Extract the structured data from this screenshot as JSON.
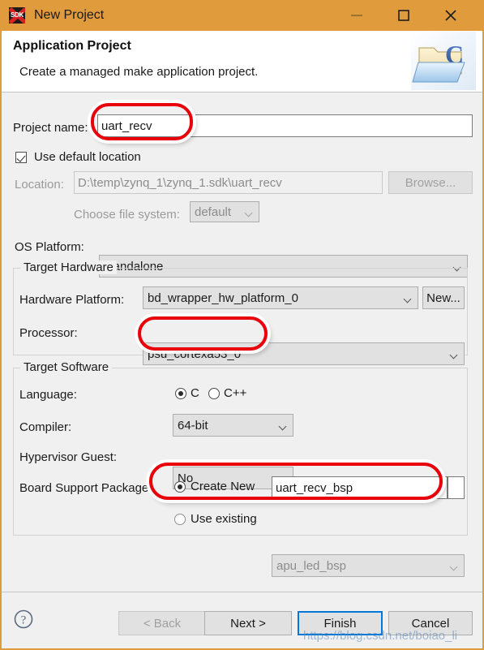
{
  "window": {
    "title": "New Project",
    "app_icon": "sdk-icon",
    "icon_label": "SDK",
    "titlebar_color": "#e09b3d",
    "controls": {
      "minimize": "minimize-icon",
      "maximize": "maximize-icon",
      "close": "close-icon"
    }
  },
  "header": {
    "title": "Application Project",
    "subtitle": "Create a managed make application project.",
    "icon": "c-project-folder-icon"
  },
  "form": {
    "project_name": {
      "label": "Project name:",
      "value": "uart_recv",
      "placeholder": ""
    },
    "use_default_location": {
      "label": "Use default location",
      "checked": true
    },
    "location": {
      "label": "Location:",
      "value": "D:\\temp\\zynq_1\\zynq_1.sdk\\uart_recv",
      "enabled": false
    },
    "browse_button": {
      "label": "Browse...",
      "enabled": false
    },
    "choose_file_system": {
      "label": "Choose file system:",
      "value": "default",
      "enabled": false
    },
    "os_platform": {
      "label": "OS Platform:",
      "value": "standalone"
    }
  },
  "target_hardware": {
    "title": "Target Hardware",
    "hardware_platform": {
      "label": "Hardware Platform:",
      "value": "bd_wrapper_hw_platform_0"
    },
    "new_button": {
      "label": "New..."
    },
    "processor": {
      "label": "Processor:",
      "value": "psu_cortexa53_0"
    }
  },
  "target_software": {
    "title": "Target Software",
    "language": {
      "label": "Language:",
      "options": [
        "C",
        "C++"
      ],
      "selected": "C"
    },
    "compiler": {
      "label": "Compiler:",
      "value": "64-bit"
    },
    "hypervisor_guest": {
      "label": "Hypervisor Guest:",
      "value": "No"
    },
    "board_support_package": {
      "label": "Board Support Package:",
      "create_new": {
        "label": "Create New",
        "selected": true,
        "value": "uart_recv_bsp"
      },
      "use_existing": {
        "label": "Use existing",
        "selected": false,
        "value": "apu_led_bsp",
        "enabled": false
      }
    }
  },
  "footer": {
    "help_icon": "help-question-icon",
    "buttons": {
      "back": {
        "label": "< Back",
        "enabled": false
      },
      "next": {
        "label": "Next >",
        "enabled": true
      },
      "finish": {
        "label": "Finish",
        "enabled": true,
        "default": true
      },
      "cancel": {
        "label": "Cancel",
        "enabled": true
      }
    }
  },
  "annotations": {
    "color": "#e8000a",
    "highlighted": [
      "project-name-input",
      "processor-combo",
      "bsp-create-new-row"
    ]
  },
  "watermark": {
    "text": "https://blog.csdn.net/boiao_li"
  }
}
